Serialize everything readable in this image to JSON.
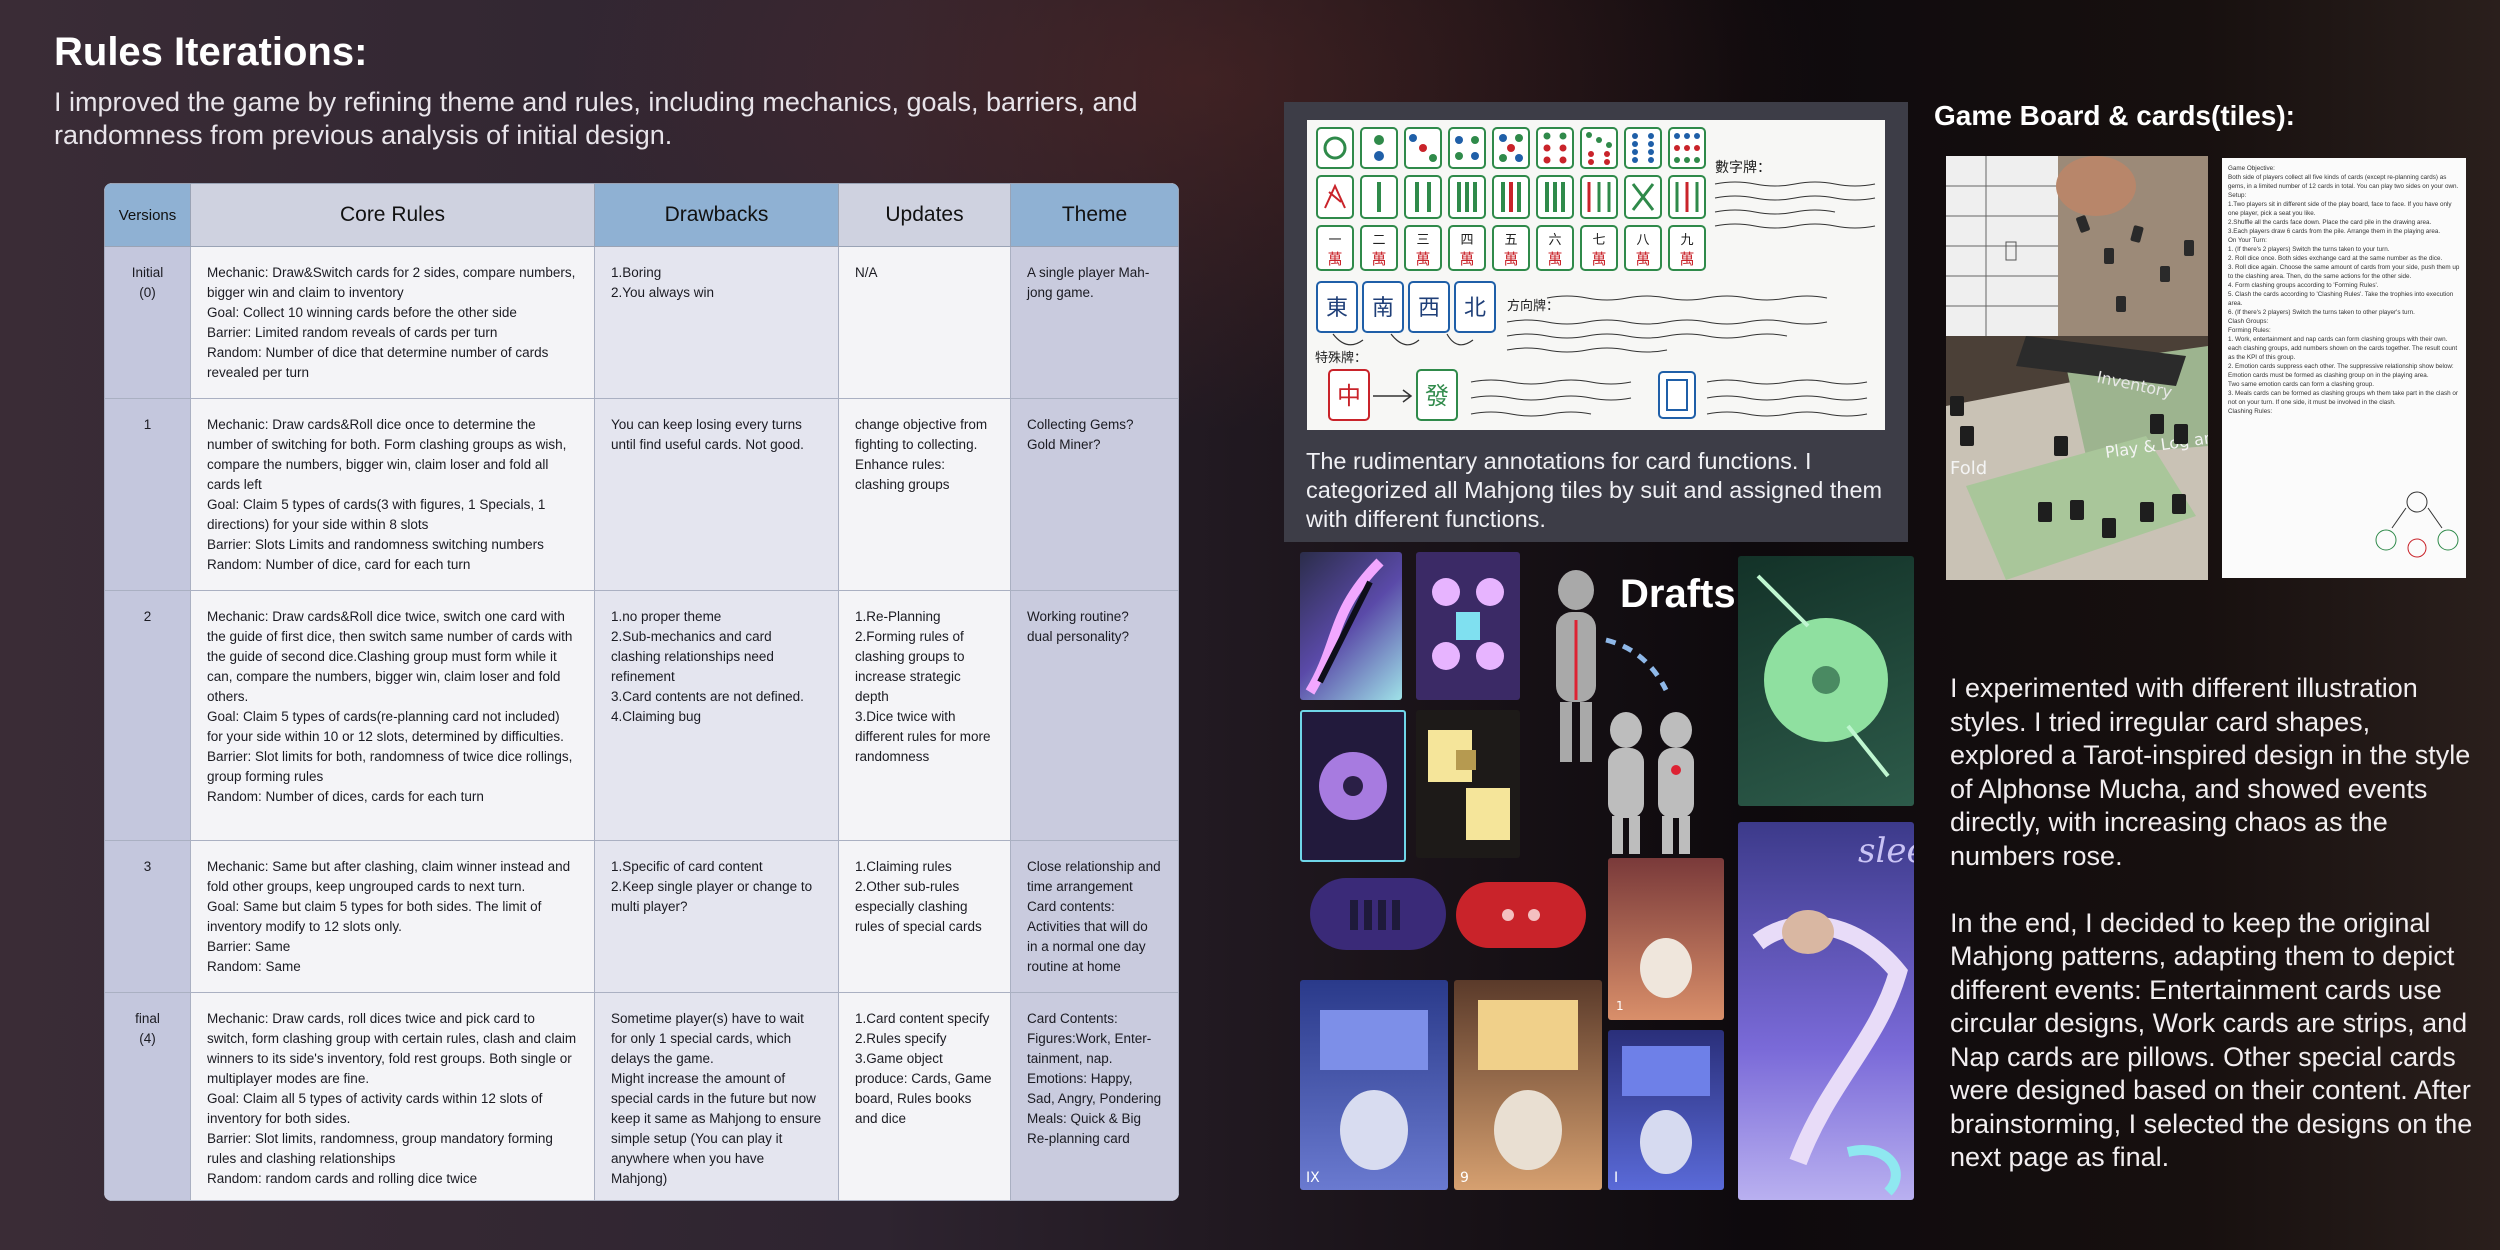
{
  "header": {
    "title": "Rules Iterations:",
    "subtitle": "I improved the game by refining theme and rules, including mechanics, goals, barriers, and randomness from previous analysis of initial design."
  },
  "table": {
    "headers": [
      "Versions",
      "Core Rules",
      "Drawbacks",
      "Updates",
      "Theme"
    ],
    "rows": [
      {
        "version": "Initial\n(0)",
        "core": "Mechanic: Draw&Switch cards for 2 sides, compare numbers, bigger win and claim to inventory\nGoal: Collect 10 winning cards before the other side\nBarrier: Limited random reveals of cards per turn\nRandom: Number of dice that determine number of cards revealed per turn",
        "drawbacks": "1.Boring\n2.You always win",
        "updates": "N/A",
        "theme": "A single player Mah-jong game."
      },
      {
        "version": "1",
        "core": "Mechanic: Draw cards&Roll dice once to determine the number of switching for both. Form clashing groups as wish, compare the numbers, bigger win, claim loser and fold all cards left\nGoal: Claim 5 types of cards(3 with figures, 1 Specials, 1 directions) for your side within 8 slots\nBarrier: Slots Limits and randomness switching numbers\nRandom: Number of dice, card for each turn",
        "drawbacks": "You can keep losing every turns until find useful cards. Not good.",
        "updates": "change objective from fighting to collecting.\nEnhance rules: clashing groups",
        "theme": "Collecting Gems?\nGold Miner?"
      },
      {
        "version": "2",
        "core": "Mechanic: Draw cards&Roll dice twice, switch one card with the guide of first dice, then switch same number of cards with the guide of second dice.Clashing group must form while it can, compare the numbers, bigger win, claim loser and fold others.\nGoal: Claim 5 types of cards(re-planning card not included) for your side within 10 or 12 slots, determined by difficulties.\nBarrier: Slot limits for both, randomness of twice dice rollings, group forming rules\nRandom: Number of dices, cards for each turn",
        "drawbacks": "1.no proper theme\n2.Sub-mechanics and card clashing relationships need refinement\n3.Card contents are not defined.\n4.Claiming bug",
        "updates": "1.Re-Planning\n2.Forming rules of clashing groups to increase strategic depth\n3.Dice twice with different rules for more randomness",
        "theme": "Working routine?\ndual personality?"
      },
      {
        "version": "3",
        "core": "Mechanic: Same but after clashing, claim winner instead and fold other groups, keep ungrouped cards to next turn.\nGoal: Same but claim 5 types for both sides. The limit of inventory modify to 12 slots only.\nBarrier: Same\nRandom: Same",
        "drawbacks": "1.Specific of card content\n2.Keep single player or change to multi player?",
        "updates": "1.Claiming rules\n2.Other sub-rules especially clashing rules of special cards",
        "theme": "Close relationship and time arrangement\nCard contents: Activities that will do in a normal one day routine at home"
      },
      {
        "version": "final\n(4)",
        "core": "Mechanic: Draw cards, roll dices twice and pick card to switch, form clashing group with certain rules, clash and claim winners to its side's inventory, fold rest groups. Both single or multiplayer modes are fine.\nGoal: Claim all 5 types of activity cards within 12 slots of inventory for both sides.\nBarrier: Slot limits, randomness, group mandatory forming rules and clashing relationships\nRandom: random cards and rolling dice twice",
        "drawbacks": "Sometime player(s) have to wait for only 1 special cards, which delays the game.\nMight increase the amount of special cards in the future but now keep it same as Mahjong to ensure simple setup (You can play it anywhere when you have Mahjong)",
        "updates": "1.Card content specify\n2.Rules specify\n3.Game object produce: Cards, Game board, Rules books and dice",
        "theme": "Card Contents:\nFigures:Work, Enter-tainment, nap.\nEmotions: Happy, Sad, Angry, Pondering\nMeals: Quick & Big\nRe-planning card"
      }
    ]
  },
  "mahjong": {
    "caption": "The rudimentary annotations for card functions. I categorized all Mahjong tiles by suit and assigned them with different functions.",
    "wan_tiles": [
      "一\n萬",
      "二\n萬",
      "三\n萬",
      "四\n萬",
      "五\n萬",
      "六\n萬",
      "七\n萬",
      "八\n萬",
      "九\n萬"
    ],
    "wind_tiles": [
      "東",
      "南",
      "西",
      "北"
    ],
    "dragon_tiles": [
      "中",
      "發"
    ],
    "note_a": "數字牌：",
    "note_b": "方向牌：",
    "note_c": "特殊牌："
  },
  "game_board": {
    "title": "Game Board & cards(tiles):",
    "photo_labels": [
      "Inventory",
      "Fold",
      "Play & Log area"
    ],
    "rules_lines": [
      "Game Objective:",
      "Both side of players collect all five kinds of cards (except re-planning cards) as gems, in a limited number of 12 cards in total. You can play two sides on your own.",
      "Setup:",
      "1.Two players sit in different side of the play board, face to face. If you have only one player, pick a seat you like.",
      "2.Shuffle all the cards face down. Place the card pile in the drawing area.",
      "3.Each players draw 6 cards from the pile. Arrange them in the playing area.",
      "On Your Turn:",
      "1. (If there's 2 players) Switch the turns taken to your turn.",
      "2. Roll dice once. Both sides exchange card at the same number as the dice.",
      "3. Roll dice again. Choose the same amount of cards from your side, push them up to the clashing area. Then, do the same actions for the other side.",
      "4. Form clashing groups according to 'Forming Rules'.",
      "5. Clash the cards according to 'Clashing Rules'. Take the trophies into execution area.",
      "6. (If there's 2 players) Switch the turns taken to other player's turn.",
      "Clash Groups:",
      "Forming Rules:",
      "1. Work, entertainment and nap cards can form clashing groups with their own.",
      "each clashing groups, add numbers shown on the cards together. The result count as the KPI of this group.",
      "2. Emotion cards suppress each other. The suppressive relationship show below:",
      "Emotion cards must be formed as clashing group on in the playing area.",
      "Two same emotion cards can form a clashing group.",
      "3. Meals cards can be formed as clashing groups wh them take part in the clash or not on your turn. If one side, it must be involved in the clash.",
      "Clashing Rules:"
    ]
  },
  "drafts": {
    "title": "Drafts",
    "card_numbers": [
      "IX",
      "9",
      "I",
      "1"
    ],
    "card_words": [
      "sleep"
    ]
  },
  "description": {
    "p1": "I experimented with different illustration styles. I tried irregular card shapes, explored a Tarot-inspired design in the style of Alphonse Mucha, and showed events directly, with increasing chaos as the numbers rose.",
    "p2": "In the end, I decided to keep the original Mahjong patterns, adapting them to depict different events: Entertainment cards use circular designs, Work cards are strips, and Nap cards are pillows. Other special cards were designed based on their content. After brainstorming, I selected the designs on the next page as final."
  },
  "colors": {
    "header_blue": "#8fb1d3",
    "header_gray": "#cfd2e0",
    "mahjong_green": "#2f8a4a",
    "mahjong_red": "#c9232a",
    "draft_purple": "#6a5fcf",
    "draft_green": "#8fe0a0"
  }
}
